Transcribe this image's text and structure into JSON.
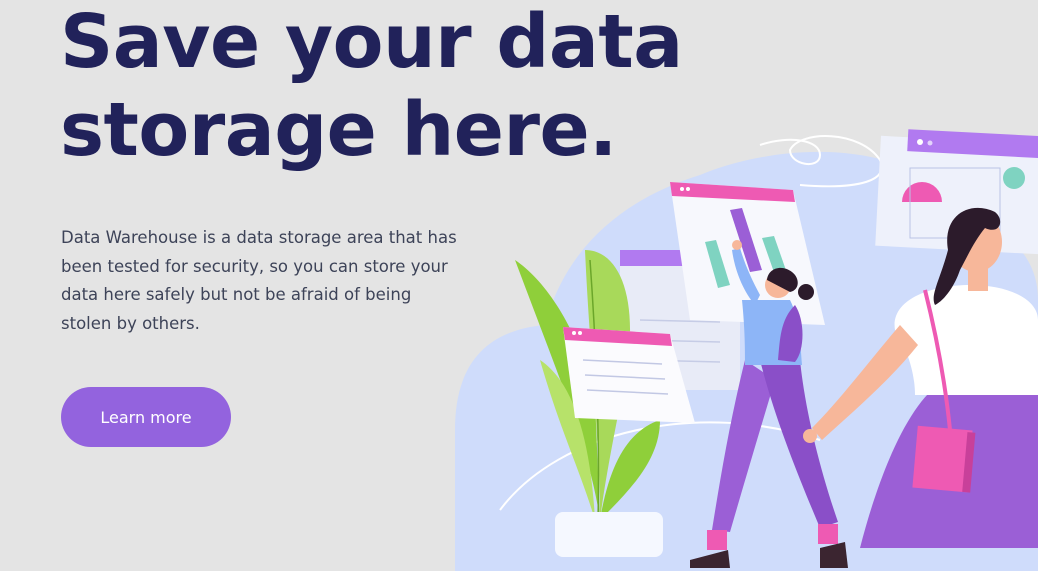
{
  "hero": {
    "headline_line1": "Save your data",
    "headline_line2": "storage here.",
    "description": "Data Warehouse is a data storage area that has been tested for security, so you can store your data here safely but not be afraid of being stolen by others.",
    "cta_label": "Learn more"
  },
  "illustration": {
    "icon": "data-storage-illustration",
    "colors": {
      "background_blob": "#cfdcfb",
      "accent_purple": "#a56ee8",
      "accent_pink": "#ee5ab3",
      "accent_teal": "#7fd3c1",
      "plant_green": "#8fcf3a",
      "skin": "#f7b79a",
      "hair": "#2c1b2b"
    }
  },
  "colors": {
    "page_background": "#e4e4e4",
    "headline": "#21225a",
    "body_text": "#3d4358",
    "button": "#9363de",
    "button_text": "#ffffff"
  }
}
